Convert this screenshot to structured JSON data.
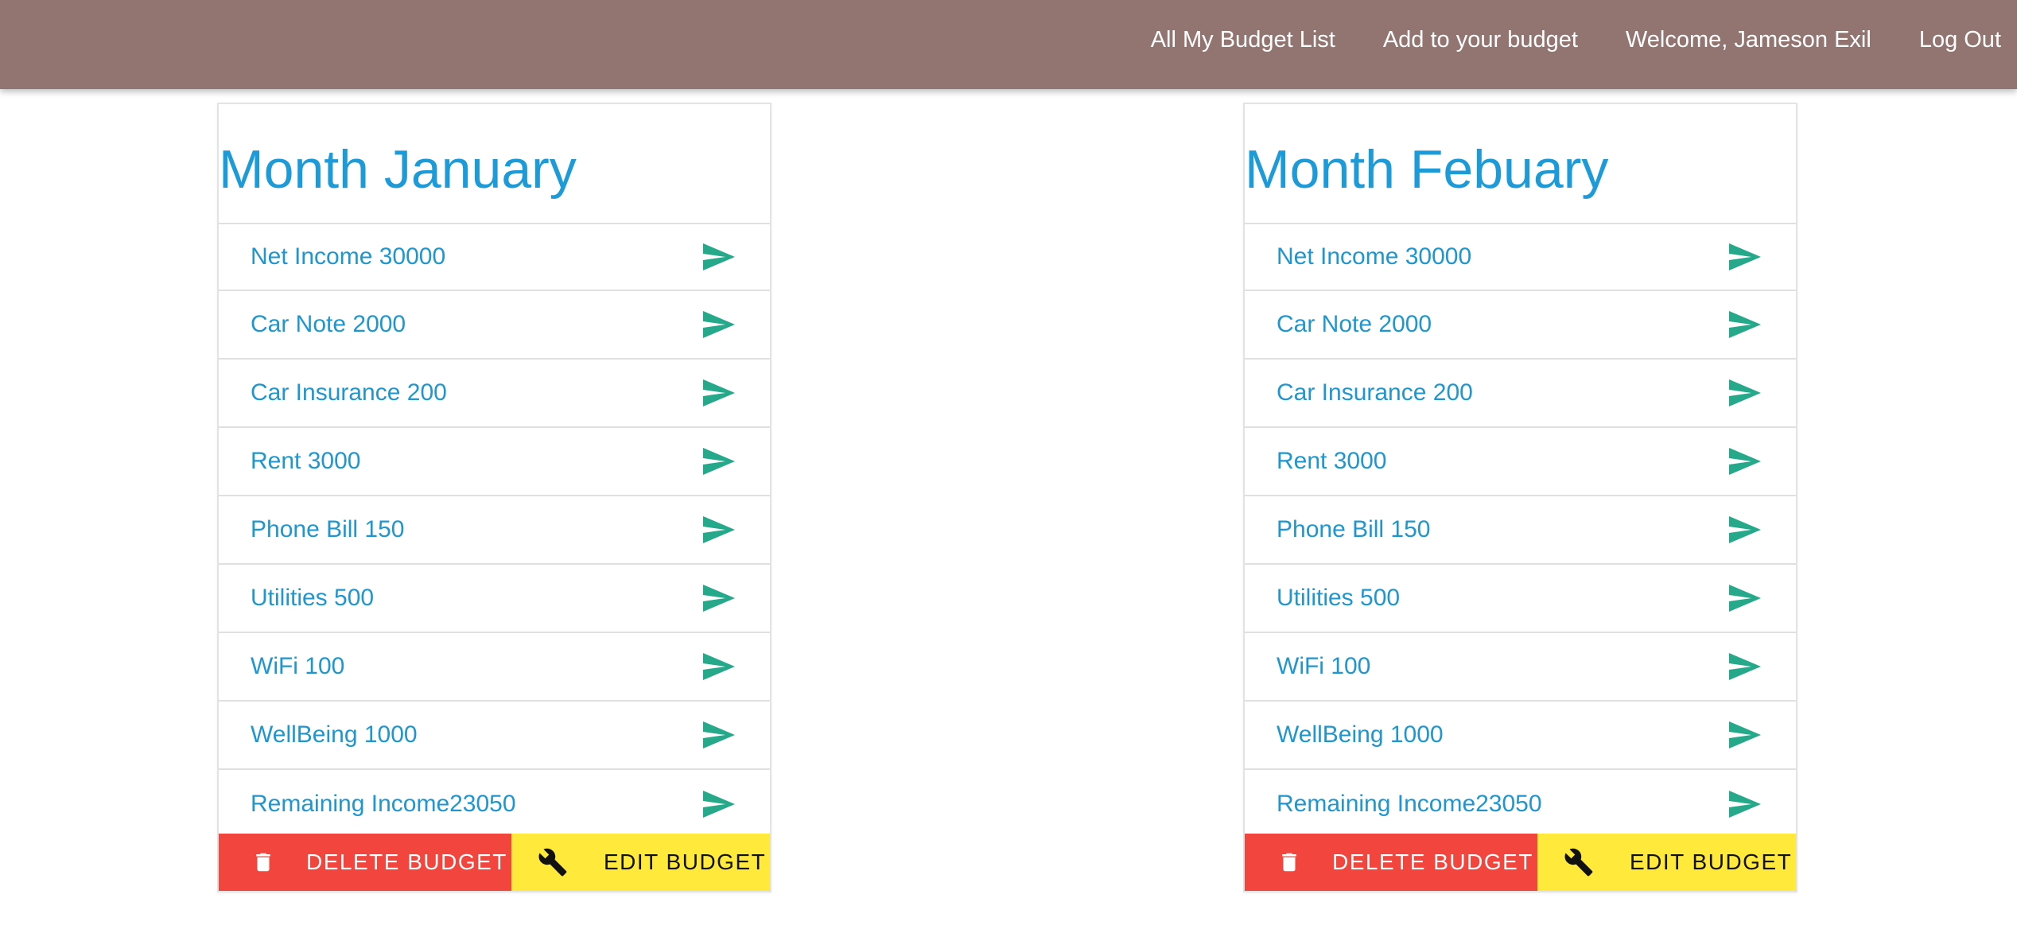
{
  "nav": {
    "links": [
      "All My Budget List",
      "Add to your budget",
      "Welcome, Jameson Exil",
      "Log Out"
    ]
  },
  "colors": {
    "navbar": "#927570",
    "title": "#1d9bd8",
    "item_text": "#1e96cf",
    "send_icon": "#26a98b",
    "delete_button": "#f2453d",
    "edit_button": "#ffea3b"
  },
  "budgets": [
    {
      "title": "Month January",
      "items": [
        "Net Income 30000",
        "Car Note 2000",
        "Car Insurance 200",
        "Rent 3000",
        "Phone Bill 150",
        "Utilities 500",
        "WiFi 100",
        "WellBeing 1000",
        "Remaining Income23050"
      ],
      "item_icon": "send-icon",
      "delete_label": "DELETE BUDGET",
      "delete_icon": "trash-icon",
      "edit_label": "EDIT BUDGET",
      "edit_icon": "wrench-icon"
    },
    {
      "title": "Month Febuary",
      "items": [
        "Net Income 30000",
        "Car Note 2000",
        "Car Insurance 200",
        "Rent 3000",
        "Phone Bill 150",
        "Utilities 500",
        "WiFi 100",
        "WellBeing 1000",
        "Remaining Income23050"
      ],
      "item_icon": "send-icon",
      "delete_label": "DELETE BUDGET",
      "delete_icon": "trash-icon",
      "edit_label": "EDIT BUDGET",
      "edit_icon": "wrench-icon"
    }
  ]
}
